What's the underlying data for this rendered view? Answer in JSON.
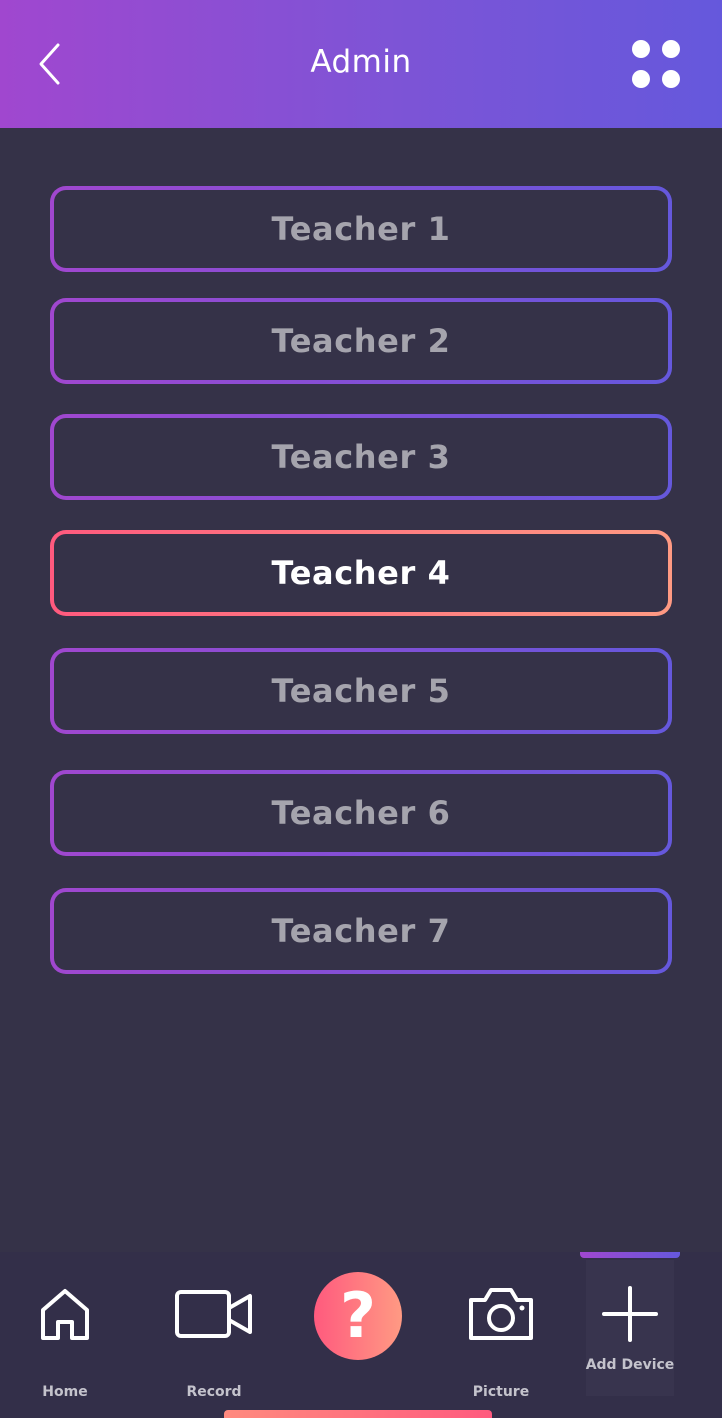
{
  "header": {
    "title": "Admin",
    "back_icon": "chevron-left-icon",
    "menu_icon": "grid-dots-icon",
    "gradient": [
      "#a047cf",
      "#6558dc"
    ]
  },
  "teachers": [
    {
      "label": "Teacher 1",
      "selected": false
    },
    {
      "label": "Teacher 2",
      "selected": false
    },
    {
      "label": "Teacher 3",
      "selected": false
    },
    {
      "label": "Teacher 4",
      "selected": true
    },
    {
      "label": "Teacher 5",
      "selected": false
    },
    {
      "label": "Teacher 6",
      "selected": false
    },
    {
      "label": "Teacher 7",
      "selected": false
    }
  ],
  "tabbar": {
    "home": {
      "label": "Home",
      "icon": "home-icon"
    },
    "record": {
      "label": "Record",
      "icon": "video-camera-icon"
    },
    "help": {
      "label": "?",
      "icon": "help-icon"
    },
    "picture": {
      "label": "Picture",
      "icon": "camera-icon"
    },
    "add_device": {
      "label": "Add Device",
      "icon": "plus-icon",
      "active": true
    }
  },
  "colors": {
    "background": "#353248",
    "accent_active": "#ff5a7e",
    "inactive_text": "#a5a4ad"
  }
}
